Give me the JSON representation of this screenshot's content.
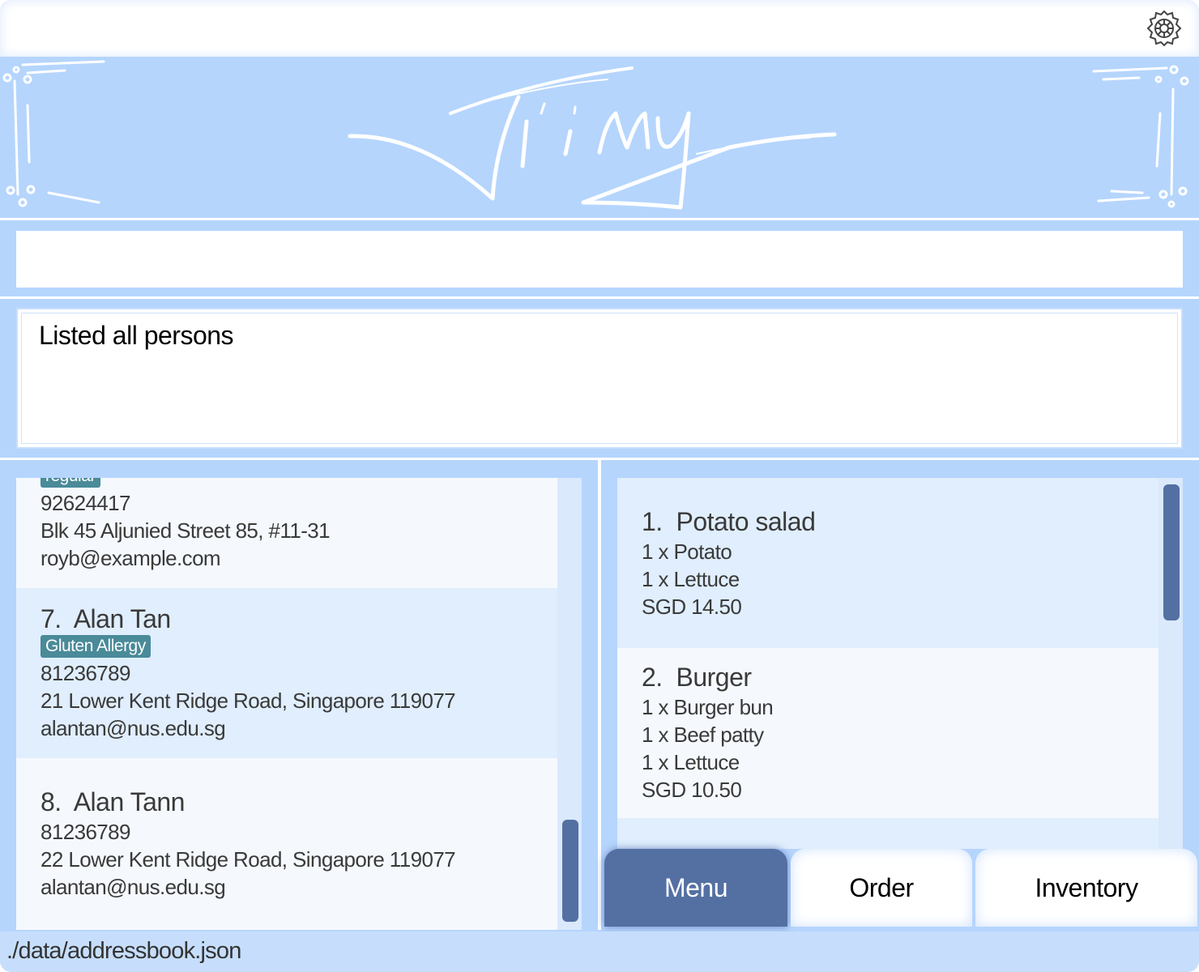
{
  "app": {
    "logo_text": "Jimy",
    "settings_icon": "gear-icon"
  },
  "command": {
    "value": "",
    "placeholder": ""
  },
  "result": {
    "message": "Listed all persons"
  },
  "persons": [
    {
      "index": "",
      "name": "",
      "tag": "regular",
      "phone": "92624417",
      "address": "Blk 45 Aljunied Street 85, #11-31",
      "email": "royb@example.com"
    },
    {
      "index": "7.",
      "name": "Alan Tan",
      "tag": "Gluten Allergy",
      "phone": "81236789",
      "address": "21 Lower Kent Ridge Road, Singapore 119077",
      "email": "alantan@nus.edu.sg"
    },
    {
      "index": "8.",
      "name": "Alan Tann",
      "tag": "",
      "phone": "81236789",
      "address": "22 Lower Kent Ridge Road, Singapore 119077",
      "email": "alantan@nus.edu.sg"
    }
  ],
  "menu_items": [
    {
      "index": "1.",
      "name": "Potato salad",
      "ingredients": [
        "1 x Potato",
        "1 x Lettuce"
      ],
      "price": "SGD 14.50"
    },
    {
      "index": "2.",
      "name": "Burger",
      "ingredients": [
        "1 x Burger bun",
        "1 x Beef patty",
        "1 x Lettuce"
      ],
      "price": "SGD 10.50"
    }
  ],
  "tabs": [
    {
      "label": "Menu",
      "active": true
    },
    {
      "label": "Order",
      "active": false
    },
    {
      "label": "Inventory",
      "active": false
    }
  ],
  "status": {
    "file_path": "./data/addressbook.json"
  },
  "colors": {
    "background": "#b5d5fd",
    "accent": "#5470a3",
    "tag": "#4a8a99",
    "card_alt": "#e0eefd"
  }
}
